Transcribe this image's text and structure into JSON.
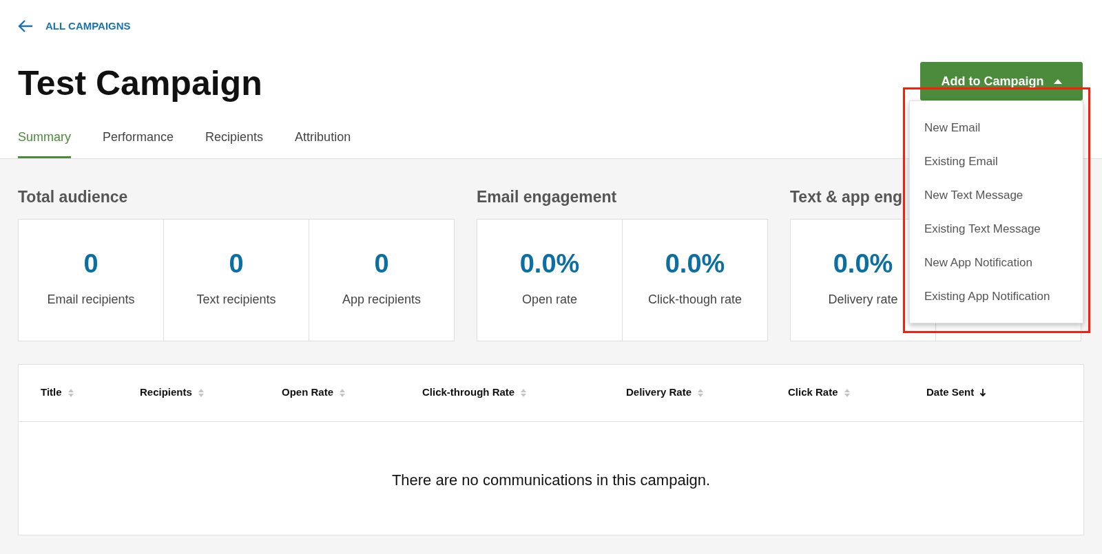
{
  "back_link": {
    "label": "ALL CAMPAIGNS"
  },
  "title": "Test Campaign",
  "add_button": {
    "label": "Add to Campaign",
    "expanded": true
  },
  "menu": {
    "items": [
      "New Email",
      "Existing Email",
      "New Text Message",
      "Existing Text Message",
      "New App Notification",
      "Existing App Notification"
    ]
  },
  "tabs": [
    {
      "label": "Summary",
      "selected": true
    },
    {
      "label": "Performance",
      "selected": false
    },
    {
      "label": "Recipients",
      "selected": false
    },
    {
      "label": "Attribution",
      "selected": false
    }
  ],
  "stat_groups": [
    {
      "heading": "Total audience",
      "cards": [
        {
          "kind": "stat",
          "value": "0",
          "label": "Email recipients"
        },
        {
          "kind": "stat",
          "value": "0",
          "label": "Text recipients"
        },
        {
          "kind": "stat",
          "value": "0",
          "label": "App recipients"
        }
      ]
    },
    {
      "heading": "Email engagement",
      "cards": [
        {
          "kind": "stat",
          "value": "0.0%",
          "label": "Open rate"
        },
        {
          "kind": "stat",
          "value": "0.0%",
          "label": "Click-though rate"
        }
      ]
    },
    {
      "heading": "Text & app eng",
      "cards": [
        {
          "kind": "stat",
          "value": "0.0%",
          "label": "Delivery rate"
        },
        {
          "kind": "covered"
        }
      ]
    }
  ],
  "table": {
    "columns": [
      {
        "label": "Title",
        "sorted": false
      },
      {
        "label": "Recipients",
        "sorted": false
      },
      {
        "label": "Open Rate",
        "sorted": false
      },
      {
        "label": "Click-through Rate",
        "sorted": false
      },
      {
        "label": "Delivery Rate",
        "sorted": false
      },
      {
        "label": "Click Rate",
        "sorted": false
      },
      {
        "label": "Date Sent",
        "sorted": true
      }
    ],
    "empty_message": "There are no communications in this campaign."
  },
  "highlight": true
}
